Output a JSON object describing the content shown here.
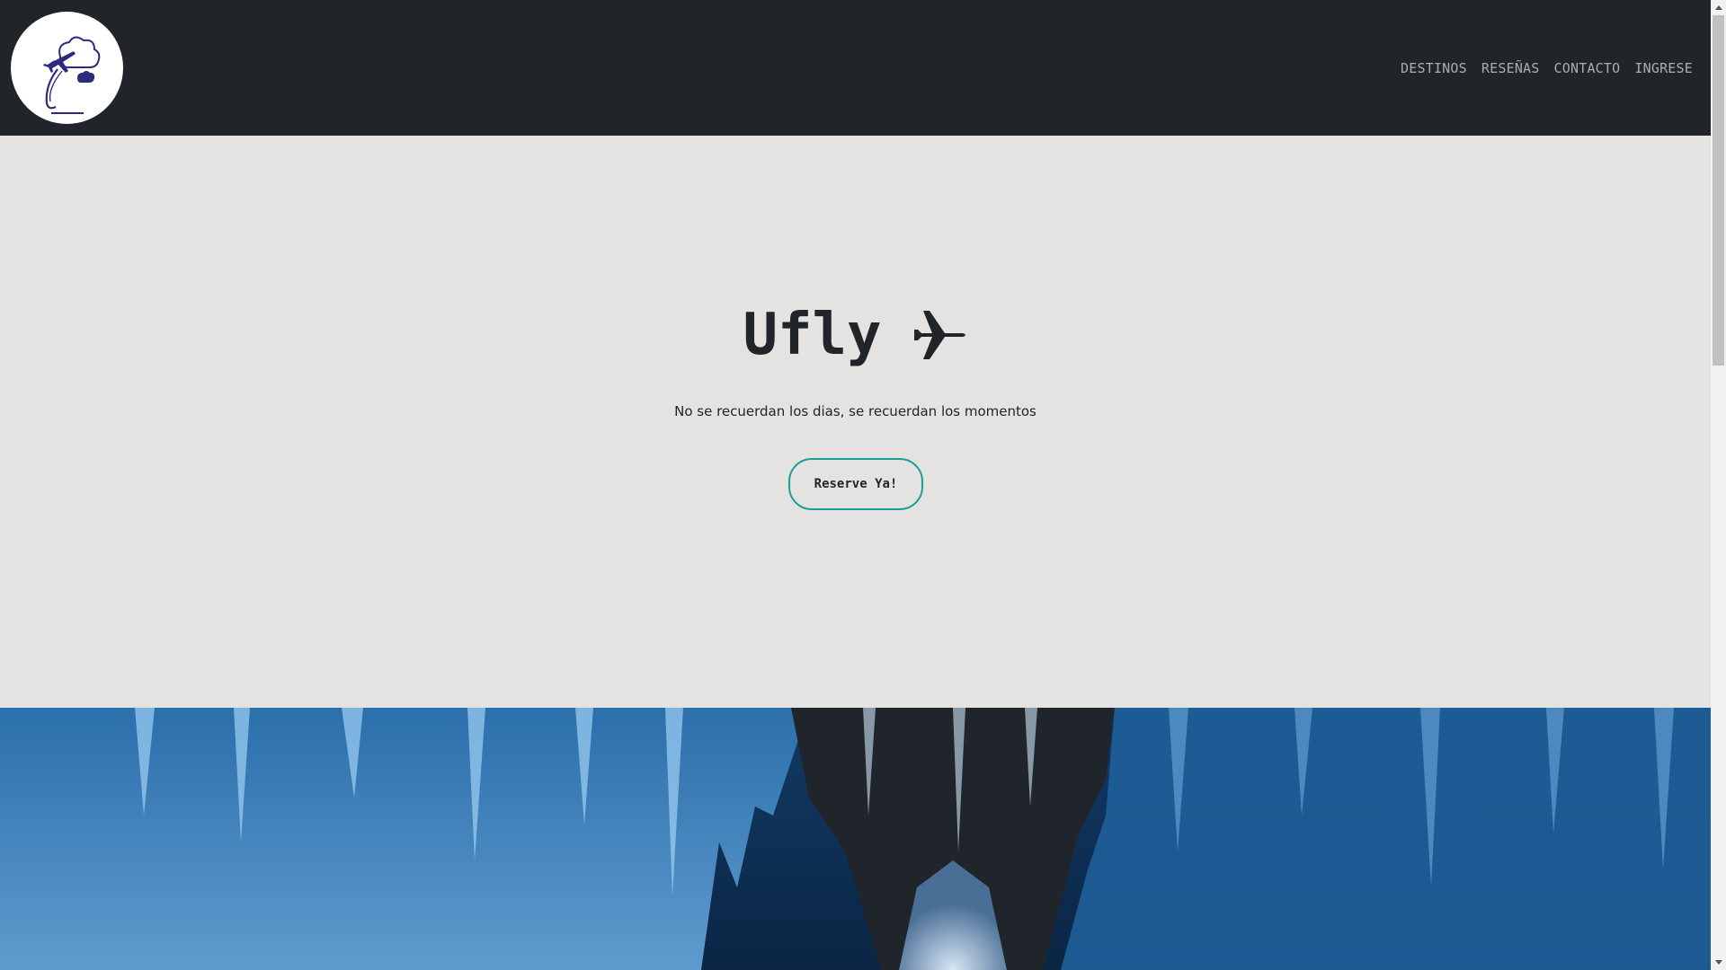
{
  "navbar": {
    "logo_icon": "ufly-plane-cloud-logo",
    "links": [
      {
        "label": "DESTINOS"
      },
      {
        "label": "RESEÑAS"
      },
      {
        "label": "CONTACTO"
      },
      {
        "label": "INGRESE"
      }
    ]
  },
  "hero": {
    "title": "Ufly",
    "title_icon": "airplane-icon",
    "tagline": "No se recuerdan los dias, se recuerdan los momentos",
    "cta_label": "Reserve Ya!"
  },
  "colors": {
    "navbar_bg": "#212529",
    "hero_bg": "#e4e3e1",
    "cta_border": "#17a096",
    "nav_link": "#a9adb2",
    "logo_ink": "#2c2a7a"
  },
  "photo": {
    "subject_icon": "ice-cave-photo"
  }
}
